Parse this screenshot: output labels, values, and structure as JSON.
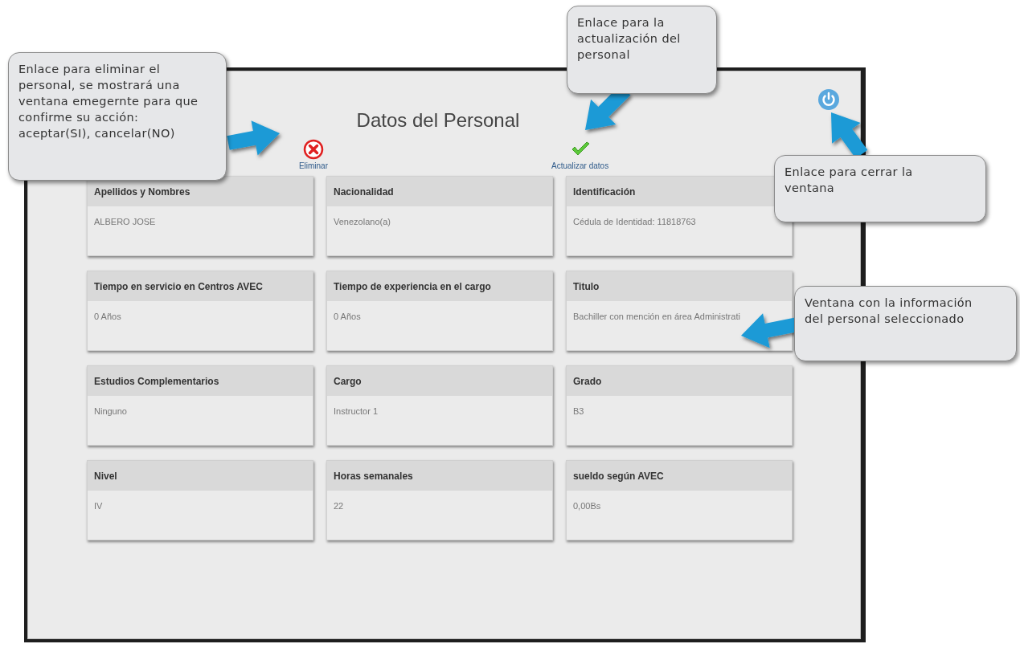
{
  "window": {
    "title": "Datos del Personal",
    "actions": [
      {
        "kind": "delete",
        "label": "Eliminar"
      },
      {
        "kind": "update",
        "label": "Actualizar datos"
      }
    ]
  },
  "fields": [
    {
      "label": "Apellidos y Nombres",
      "value": "ALBERO JOSE"
    },
    {
      "label": "Nacionalidad",
      "value": "Venezolano(a)"
    },
    {
      "label": "Identificación",
      "value": "Cédula de Identidad: 11818763"
    },
    {
      "label": "Tiempo en servicio en Centros AVEC",
      "value": "0 Años"
    },
    {
      "label": "Tiempo de experiencia en el cargo",
      "value": "0 Años"
    },
    {
      "label": "Titulo",
      "value": "Bachiller con mención en área Administrati"
    },
    {
      "label": "Estudios Complementarios",
      "value": "Ninguno"
    },
    {
      "label": "Cargo",
      "value": "Instructor 1"
    },
    {
      "label": "Grado",
      "value": "B3"
    },
    {
      "label": "Nivel",
      "value": "IV"
    },
    {
      "label": "Horas semanales",
      "value": "22"
    },
    {
      "label": "sueldo según AVEC",
      "value": "0,00Bs"
    }
  ],
  "callouts": [
    {
      "text": "Enlace para eliminar el personal, se mostrará una ventana emegernte para que confirme su acción: aceptar(SI), cancelar(NO)"
    },
    {
      "text": "Enlace para la actualización del personal"
    },
    {
      "text": "Enlace para cerrar la ventana"
    },
    {
      "text": "Ventana con la información del personal seleccionado"
    }
  ]
}
